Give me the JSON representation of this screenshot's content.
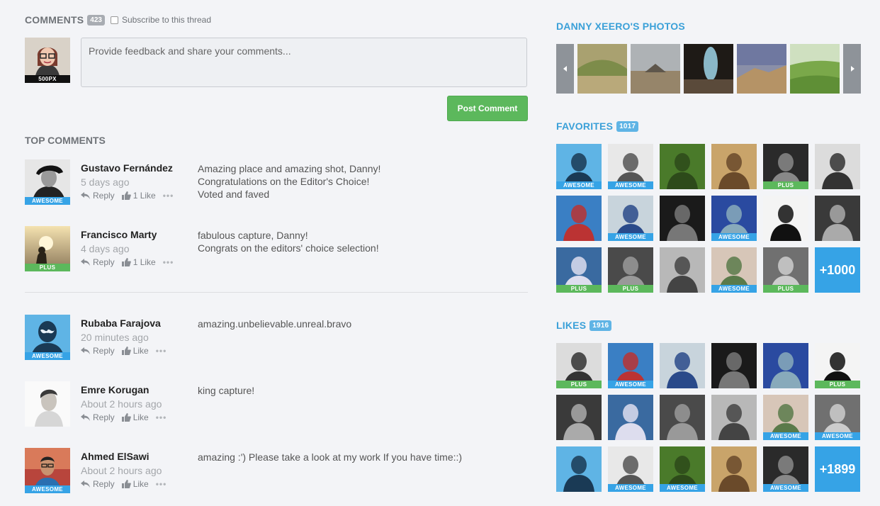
{
  "comments": {
    "title": "COMMENTS",
    "count": "423",
    "subscribe_label": "Subscribe to this thread",
    "my_avatar_badge": "500PX",
    "input_placeholder": "Provide feedback and share your comments...",
    "post_button": "Post Comment",
    "top_comments_title": "TOP COMMENTS",
    "actions": {
      "reply": "Reply"
    },
    "top": [
      {
        "name": "Gustavo Fernández",
        "time": "5 days ago",
        "like": "1 Like",
        "badge": "AWESOME",
        "text": "Amazing place and amazing shot, Danny!\nCongratulations on the Editor's Choice!\nVoted and faved"
      },
      {
        "name": "Francisco Marty",
        "time": "4 days ago",
        "like": "1 Like",
        "badge": "PLUS",
        "text": "fabulous capture, Danny!\nCongrats on the editors' choice selection!"
      }
    ],
    "recent": [
      {
        "name": "Rubaba Farajova",
        "time": "20 minutes ago",
        "like": "Like",
        "badge": "AWESOME",
        "text": "amazing.unbelievable.unreal.bravo"
      },
      {
        "name": "Emre Korugan",
        "time": "About 2 hours ago",
        "like": "Like",
        "badge": "",
        "text": "king capture!"
      },
      {
        "name": "Ahmed ElSawi",
        "time": "About 2 hours ago",
        "like": "Like",
        "badge": "AWESOME",
        "text": "amazing :') Please take a look at my work If you have time::)"
      }
    ]
  },
  "sidebar": {
    "photos_title": "DANNY XEERO'S PHOTOS",
    "favorites_title": "FAVORITES",
    "favorites_count": "1017",
    "favorites_more": "+1000",
    "likes_title": "LIKES",
    "likes_count": "1916",
    "likes_more": "+1899",
    "favorites_badges": [
      "AWESOME",
      "AWESOME",
      "",
      "",
      "PLUS",
      "",
      "",
      "AWESOME",
      "",
      "AWESOME",
      "",
      "",
      "PLUS",
      "PLUS",
      "",
      "AWESOME",
      "PLUS"
    ],
    "likes_badges": [
      "PLUS",
      "AWESOME",
      "",
      "",
      "",
      "PLUS",
      "",
      "",
      "",
      "",
      "AWESOME",
      "AWESOME",
      "",
      "AWESOME",
      "AWESOME",
      "",
      "AWESOME"
    ]
  },
  "colors": {
    "accent_blue": "#36a3e6",
    "title_blue": "#3aa0d8",
    "plus_green": "#5cb85c",
    "background": "#f3f4f7"
  }
}
